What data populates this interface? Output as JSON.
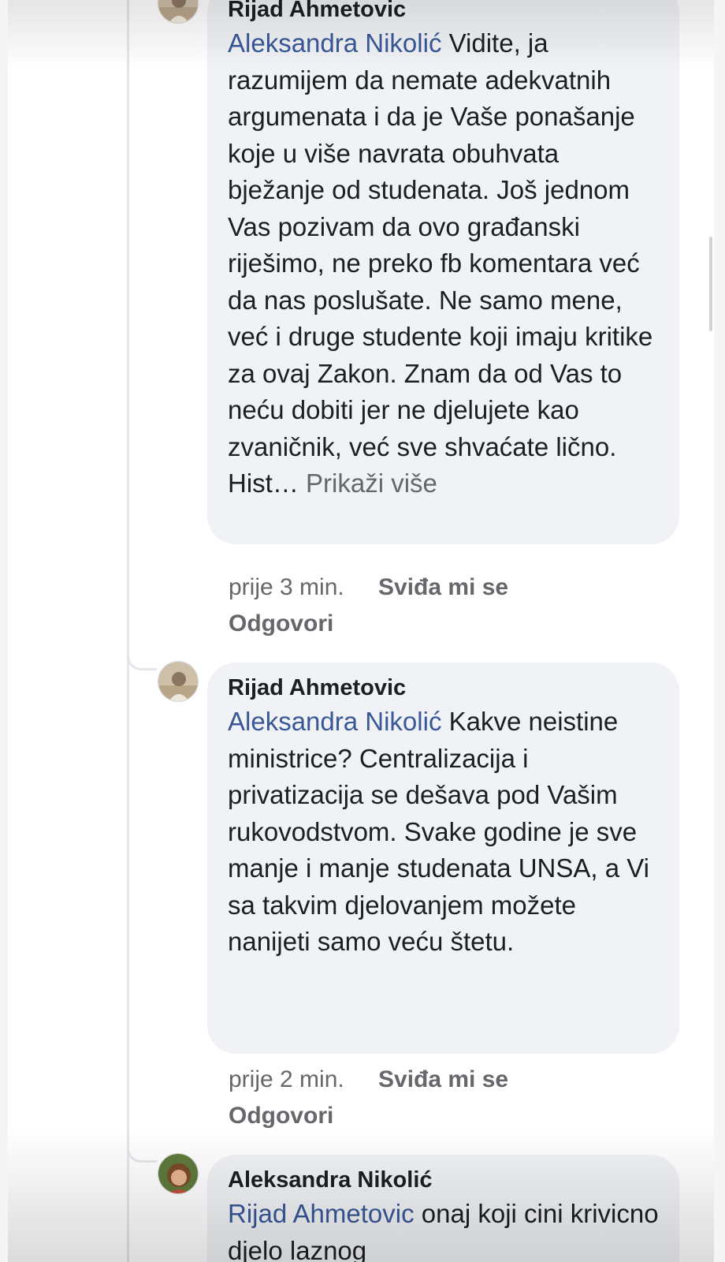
{
  "comments": [
    {
      "author": "Rijad Ahmetovic",
      "mention": "Aleksandra Nikolić",
      "text": " Vidite, ja razumijem da nemate adekvatnih argumenata i da je Vaše ponašanje koje u više navrata obuhvata bježanje od studenata. Još jednom Vas pozivam da ovo građanski riješimo, ne preko fb komentara već da nas poslušate. Ne samo mene, već i druge studente koji imaju kritike za ovaj Zakon. Znam da od Vas to neću dobiti jer ne djelujete kao zvaničnik, već sve shvaćate lično. Hist…",
      "more": "Prikaži više",
      "time": "prije 3 min.",
      "like": "Sviđa mi se",
      "reply": "Odgovori"
    },
    {
      "author": "Rijad Ahmetovic",
      "mention": "Aleksandra Nikolić",
      "text": " Kakve neistine ministrice? Centralizacija i privatizacija se dešava pod Vašim rukovodstvom. Svake godine je sve manje i manje studenata UNSA, a Vi sa takvim djelovanjem možete nanijeti samo veću štetu.",
      "time": "prije 2 min.",
      "like": "Sviđa mi se",
      "reply": "Odgovori"
    },
    {
      "author": "Aleksandra Nikolić",
      "mention": "Rijad Ahmetovic",
      "text": " onaj koji cini krivicno djelo laznog"
    }
  ],
  "colors": {
    "mention": "#385898",
    "bubble": "#f0f2f5",
    "meta": "#65676b",
    "text": "#1c1e21"
  }
}
